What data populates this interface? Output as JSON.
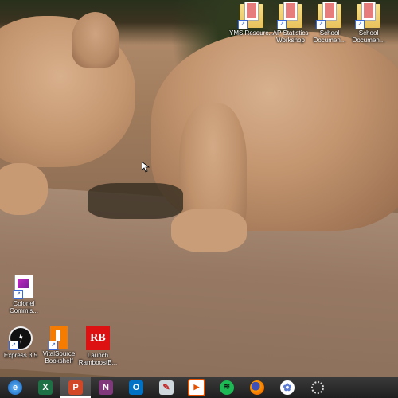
{
  "desktop_icons": {
    "yms": "YMS Resourc...",
    "ap_stats": "AP Statistics Workshop",
    "school1": "School Documen...",
    "school2": "School Documen...",
    "colonel": "Colonel Commis...",
    "express": "Express 3.5",
    "vitalsource": "VitalSource Bookshelf",
    "rambook": "Launch RamboostB...",
    "rb_logo": "RB"
  },
  "taskbar": {
    "apps": [
      {
        "name": "IE",
        "color": "#1e88e5"
      },
      {
        "name": "Excel",
        "color": "#1e7145"
      },
      {
        "name": "PowerPoint",
        "color": "#d24726"
      },
      {
        "name": "OneNote",
        "color": "#80397b"
      },
      {
        "name": "Outlook",
        "color": "#0072c6"
      },
      {
        "name": "Paint",
        "color": "#b9c8d8"
      },
      {
        "name": "Media",
        "color": "#e65100"
      },
      {
        "name": "Spotify",
        "color": "#1db954"
      },
      {
        "name": "Firefox",
        "color": "#e66000"
      },
      {
        "name": "Settings",
        "color": "#5b7bd5"
      },
      {
        "name": "Loading",
        "color": "#dddddd"
      }
    ]
  }
}
